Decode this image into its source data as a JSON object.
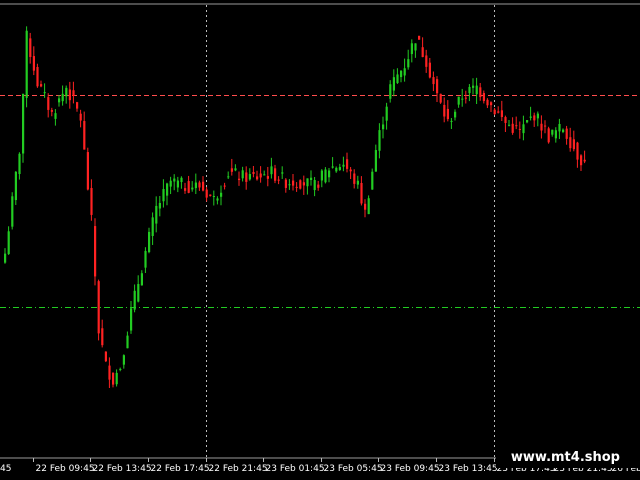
{
  "watermark": "www.mt4.shop",
  "chart_data": {
    "type": "candlestick",
    "background": "#000000",
    "bull_color": "#22cc22",
    "bear_color": "#ff2222",
    "grid": true,
    "x_tick_labels": [
      "22 Feb 09:45",
      "22 Feb 13:45",
      "22 Feb 17:45",
      "22 Feb 21:45",
      "23 Feb 01:45",
      "23 Feb 05:45",
      "23 Feb 09:45",
      "23 Feb 13:45",
      "23 Feb 17:45",
      "23 Feb 21:45",
      "26 Feb 01:45"
    ],
    "x_tick_first_partial": "45",
    "x_tick_index_spacing": 16,
    "first_tick_index": 8,
    "vertical_gridline_ticks": [
      "22 Feb 21:45",
      "23 Feb 17:45"
    ],
    "y_range": [
      0,
      100
    ],
    "levels": [
      {
        "name": "red-dashed-level",
        "value": 80.3,
        "color": "#ff4d4d",
        "style": "dashed"
      },
      {
        "name": "green-dashdot-level",
        "value": 33.2,
        "color": "#22cc22",
        "style": "dashdot"
      }
    ],
    "close_anchors": [
      [
        0,
        45
      ],
      [
        4,
        68
      ],
      [
        6,
        93
      ],
      [
        9,
        83
      ],
      [
        13,
        76
      ],
      [
        17,
        82
      ],
      [
        21,
        75
      ],
      [
        24,
        52
      ],
      [
        26,
        28
      ],
      [
        28,
        20
      ],
      [
        30,
        17
      ],
      [
        32,
        20
      ],
      [
        35,
        32
      ],
      [
        38,
        42
      ],
      [
        42,
        55
      ],
      [
        46,
        61
      ],
      [
        50,
        60
      ],
      [
        54,
        60
      ],
      [
        58,
        57
      ],
      [
        62,
        63
      ],
      [
        66,
        62
      ],
      [
        70,
        62
      ],
      [
        74,
        63
      ],
      [
        78,
        61
      ],
      [
        82,
        61
      ],
      [
        86,
        60
      ],
      [
        90,
        64
      ],
      [
        94,
        65
      ],
      [
        98,
        60
      ],
      [
        100,
        54
      ],
      [
        103,
        68
      ],
      [
        107,
        82
      ],
      [
        111,
        87
      ],
      [
        114,
        93
      ],
      [
        117,
        88
      ],
      [
        120,
        80
      ],
      [
        123,
        74
      ],
      [
        127,
        80
      ],
      [
        131,
        82
      ],
      [
        135,
        78
      ],
      [
        139,
        74
      ],
      [
        143,
        72
      ],
      [
        147,
        76
      ],
      [
        151,
        71
      ],
      [
        155,
        73
      ],
      [
        159,
        67
      ],
      [
        161,
        65
      ]
    ]
  }
}
